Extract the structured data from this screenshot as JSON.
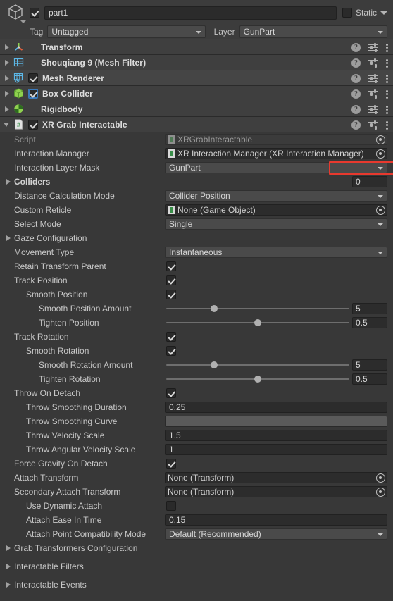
{
  "object_header": {
    "icon": "cube-icon",
    "enabled_checkbox": true,
    "name_value": "part1",
    "static_label": "Static",
    "static_checked": false,
    "tag_label": "Tag",
    "tag_value": "Untagged",
    "layer_label": "Layer",
    "layer_value": "GunPart"
  },
  "components": [
    {
      "name": "Transform",
      "icon": "transform-icon",
      "expanded": false,
      "has_toggle": false,
      "toggle_on": false,
      "toggle_focus": false
    },
    {
      "name": "Shouqiang 9 (Mesh Filter)",
      "icon": "mesh-filter-icon",
      "expanded": false,
      "has_toggle": false,
      "toggle_on": false,
      "toggle_focus": false
    },
    {
      "name": "Mesh Renderer",
      "icon": "mesh-renderer-icon",
      "expanded": false,
      "has_toggle": true,
      "toggle_on": true,
      "toggle_focus": false
    },
    {
      "name": "Box Collider",
      "icon": "box-collider-icon",
      "expanded": false,
      "has_toggle": true,
      "toggle_on": true,
      "toggle_focus": true
    },
    {
      "name": "Rigidbody",
      "icon": "rigidbody-icon",
      "expanded": false,
      "has_toggle": false,
      "toggle_on": false,
      "toggle_focus": false
    },
    {
      "name": "XR Grab Interactable",
      "icon": "script-icon",
      "expanded": true,
      "has_toggle": true,
      "toggle_on": true,
      "toggle_focus": false
    }
  ],
  "header_icons": {
    "help": "?",
    "settings": "settings-icon",
    "menu": "menu-icon"
  },
  "properties": [
    {
      "label": "Script",
      "dim": true,
      "type": "object",
      "value": "XRGrabInteractable",
      "disabled": true
    },
    {
      "label": "Interaction Manager",
      "type": "object",
      "value": "XR Interaction Manager (XR Interaction Manager)"
    },
    {
      "label": "Interaction Layer Mask",
      "type": "dropdown",
      "value": "GunPart",
      "highlighted": true
    },
    {
      "label": "Colliders",
      "type": "foldout-count",
      "bold": true,
      "count": "0"
    },
    {
      "label": "Distance Calculation Mode",
      "type": "dropdown",
      "value": "Collider Position"
    },
    {
      "label": "Custom Reticle",
      "type": "object",
      "value": "None (Game Object)"
    },
    {
      "label": "Select Mode",
      "type": "dropdown",
      "value": "Single"
    },
    {
      "label": "Gaze Configuration",
      "type": "foldout"
    },
    {
      "label": "Movement Type",
      "type": "dropdown",
      "value": "Instantaneous"
    },
    {
      "label": "Retain Transform Parent",
      "type": "checkbox",
      "checked": true
    },
    {
      "label": "Track Position",
      "type": "checkbox",
      "checked": true
    },
    {
      "label": "Smooth Position",
      "indent": 1,
      "type": "checkbox",
      "checked": true
    },
    {
      "label": "Smooth Position Amount",
      "indent": 2,
      "type": "slider",
      "value": "5",
      "knob_pct": 26
    },
    {
      "label": "Tighten Position",
      "indent": 2,
      "type": "slider",
      "value": "0.5",
      "knob_pct": 50
    },
    {
      "label": "Track Rotation",
      "type": "checkbox",
      "checked": true
    },
    {
      "label": "Smooth Rotation",
      "indent": 1,
      "type": "checkbox",
      "checked": true
    },
    {
      "label": "Smooth Rotation Amount",
      "indent": 2,
      "type": "slider",
      "value": "5",
      "knob_pct": 26
    },
    {
      "label": "Tighten Rotation",
      "indent": 2,
      "type": "slider",
      "value": "0.5",
      "knob_pct": 50
    },
    {
      "label": "Throw On Detach",
      "type": "checkbox",
      "checked": true
    },
    {
      "label": "Throw Smoothing Duration",
      "indent": 1,
      "type": "text",
      "value": "0.25"
    },
    {
      "label": "Throw Smoothing Curve",
      "indent": 1,
      "type": "curve"
    },
    {
      "label": "Throw Velocity Scale",
      "indent": 1,
      "type": "text",
      "value": "1.5"
    },
    {
      "label": "Throw Angular Velocity Scale",
      "indent": 1,
      "type": "text",
      "value": "1"
    },
    {
      "label": "Force Gravity On Detach",
      "type": "checkbox",
      "checked": true
    },
    {
      "label": "Attach Transform",
      "type": "object",
      "value": "None (Transform)",
      "no_icon": true
    },
    {
      "label": "Secondary Attach Transform",
      "type": "object",
      "value": "None (Transform)",
      "no_icon": true
    },
    {
      "label": "Use Dynamic Attach",
      "indent": 1,
      "type": "checkbox",
      "checked": false
    },
    {
      "label": "Attach Ease In Time",
      "indent": 1,
      "type": "text",
      "value": "0.15"
    },
    {
      "label": "Attach Point Compatibility Mode",
      "indent": 1,
      "type": "dropdown",
      "value": "Default (Recommended)"
    },
    {
      "label": "Grab Transformers Configuration",
      "type": "foldout"
    },
    {
      "label": "Interactable Filters",
      "type": "foldout",
      "spaced": true
    },
    {
      "label": "Interactable Events",
      "type": "foldout",
      "spaced": true
    }
  ],
  "colors": {
    "background": "#383838",
    "header_row": "#3f3f3f",
    "highlight": "#e8392e",
    "field_dark": "#2c2c2c",
    "field_mid": "#4a4a4a",
    "green_icon": "#8fd14f",
    "blue_icon": "#5cb8e8"
  }
}
